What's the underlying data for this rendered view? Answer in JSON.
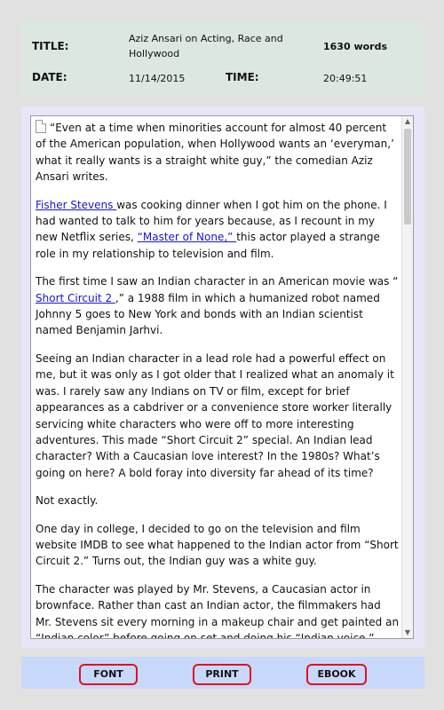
{
  "header": {
    "title_label": "TITLE:",
    "title_value": "Aziz Ansari on Acting, Race and Hollywood",
    "word_count": "1630 words",
    "date_label": "DATE:",
    "date_value": "11/14/2015",
    "time_label": "TIME:",
    "time_value": "20:49:51"
  },
  "article": {
    "p1": "“Even at a time when minorities account for almost 40 percent of the American population, when Hollywood wants an ‘everyman,’ what it really wants is a straight white guy,” the comedian Aziz Ansari writes.",
    "p2_link1": "Fisher Stevens ",
    "p2_text1": "was cooking dinner when I got him on the phone. I had wanted to talk to him for years because, as I recount in my new Netflix series, ",
    "p2_link2": "“Master of None,” ",
    "p2_text2": "this actor played a strange role in my relationship to television and film.",
    "p3_text1": "The first time I saw an Indian character in an American movie was “ ",
    "p3_link": "Short Circuit 2 ",
    "p3_text2": ",” a 1988 film in which a humanized robot named Johnny 5 goes to New York and bonds with an Indian scientist named Benjamin Jarhvi.",
    "p4": "Seeing an Indian character in a lead role had a powerful effect on me, but it was only as I got older that I realized what an anomaly it was. I rarely saw any Indians on TV or film, except for brief appearances as a cabdriver or a convenience store worker literally servicing white characters who were off to more interesting adventures. This made “Short Circuit 2” special. An Indian lead character? With a Caucasian love interest? In the 1980s? What’s going on here? A bold foray into diversity far ahead of its time?",
    "p5": "Not exactly.",
    "p6": "One day in college, I decided to go on the television and film website IMDB to see what happened to the Indian actor from “Short Circuit 2.” Turns out, the Indian guy was a white guy.",
    "p7": "The character was played by Mr. Stevens, a Caucasian actor in brownface. Rather than cast an Indian actor, the filmmakers had Mr. Stevens sit every morning in a makeup chair and get painted an “Indian color” before going on set and doing his “Indian voice.”"
  },
  "scrollbar": {
    "up_glyph": "▲",
    "down_glyph": "▼"
  },
  "footer": {
    "font_label": "FONT",
    "print_label": "PRINT",
    "ebook_label": "EBOOK"
  },
  "colors": {
    "accent_red": "#e0131b",
    "link_blue": "#1a13d0",
    "header_bg": "#dce8df",
    "footer_bg": "#c8d8fb"
  }
}
